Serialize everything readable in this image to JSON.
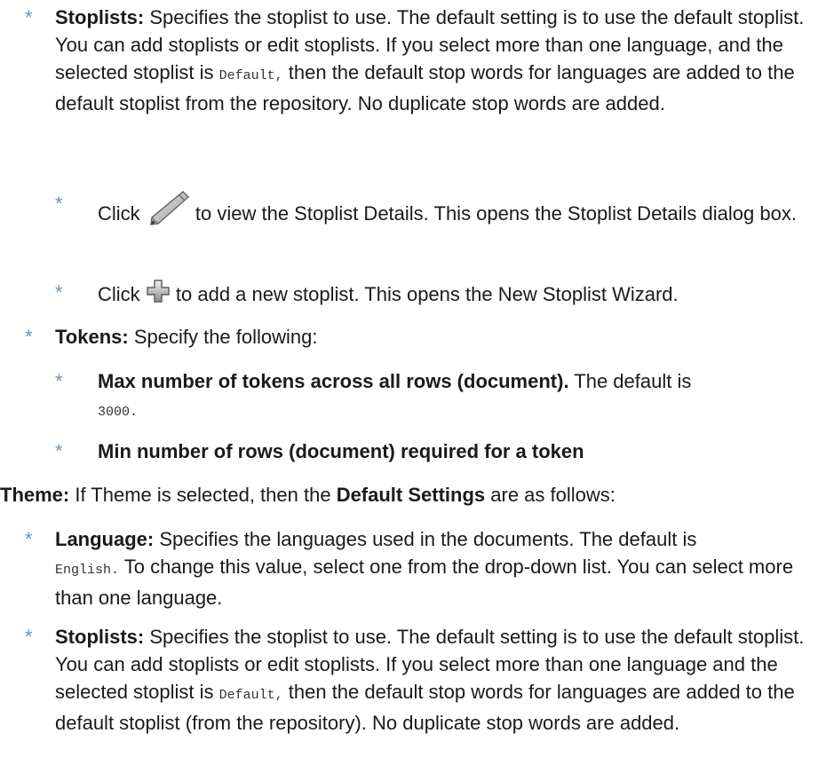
{
  "bullet_marker": "*",
  "stoplists_1": {
    "label": "Stoplists:",
    "text_a": " Specifies the stoplist to use. The default setting is to use the default stoplist. You can add stoplists or edit stoplists. If you select more than one language, and the selected stoplist is ",
    "code": "Default,",
    "text_b": " then the default stop words for languages are added to the default stoplist from the repository. No duplicate stop words are added."
  },
  "click_edit": {
    "pre": "Click ",
    "icon": "pencil-icon",
    "post": " to view the Stoplist Details. This opens the Stoplist Details dialog box."
  },
  "click_add": {
    "pre": "Click ",
    "icon": "plus-icon",
    "post": " to add a new stoplist. This opens the New Stoplist Wizard."
  },
  "tokens": {
    "label": "Tokens:",
    "text": " Specify the following:"
  },
  "max_tokens": {
    "label": "Max number of tokens across all rows (document).",
    "text": " The default is",
    "code": "3000."
  },
  "min_rows": {
    "label": "Min number of rows (document) required for a token"
  },
  "theme": {
    "label": "Theme:",
    "text_a": " If Theme is selected, then the ",
    "bold": "Default Settings",
    "text_b": " are as follows:"
  },
  "language": {
    "label": "Language:",
    "text_a": " Specifies the languages used in the documents. The default is",
    "code": "English.",
    "text_b": " To change this value, select one from the drop-down list. You can select more than one language."
  },
  "stoplists_2": {
    "label": "Stoplists:",
    "text_a": " Specifies the stoplist to use. The default setting is to use the default stoplist. You can add stoplists or edit stoplists. If you select more than one language and the selected stoplist is ",
    "code": "Default,",
    "text_b": " then the default stop words for languages are added to the default stoplist (from the repository). No duplicate stop words are added."
  },
  "colors": {
    "bullet": "#6d93c2",
    "text": "#1a1a1a"
  }
}
